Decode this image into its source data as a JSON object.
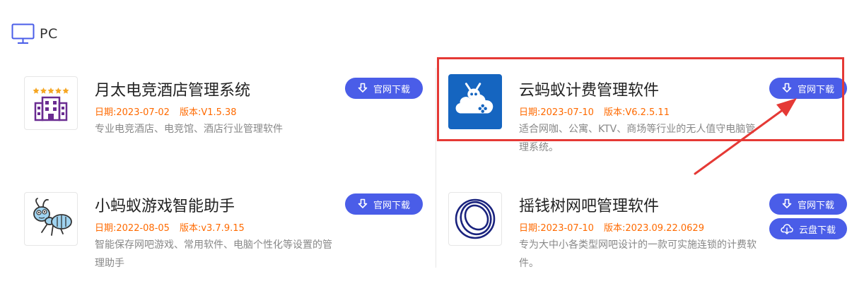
{
  "section": {
    "title": "PC",
    "icon": "monitor-icon"
  },
  "cards": [
    {
      "title": "月太电竞酒店管理系统",
      "date": "日期:2023-07-02",
      "version": "版本:V1.5.38",
      "description": "专业电竞酒店、电竞馆、酒店行业管理软件",
      "logo": "hotel-building-icon",
      "buttons": [
        {
          "label": "官网下载",
          "icon": "download-icon"
        }
      ]
    },
    {
      "title": "云蚂蚁计费管理软件",
      "date": "日期:2023-07-10",
      "version": "版本:V6.2.5.11",
      "description": "适合网咖、公寓、KTV、商场等行业的无人值守电脑管理系统。",
      "logo": "cloud-ant-gamepad-icon",
      "buttons": [
        {
          "label": "官网下载",
          "icon": "download-icon"
        }
      ]
    },
    {
      "title": "小蚂蚁游戏智能助手",
      "date": "日期:2022-08-05",
      "version": "版本:v3.7.9.15",
      "description": "智能保存网吧游戏、常用软件、电脑个性化等设置的管理助手",
      "logo": "ant-mascot-icon",
      "buttons": [
        {
          "label": "官网下载",
          "icon": "download-icon"
        }
      ]
    },
    {
      "title": "摇钱树网吧管理软件",
      "date": "日期:2023-07-10",
      "version": "版本:2023.09.22.0629",
      "description": "专为大中小各类型网吧设计的一款可实施连锁的计费软件。",
      "logo": "blue-rings-icon",
      "buttons": [
        {
          "label": "官网下载",
          "icon": "download-icon"
        },
        {
          "label": "云盘下载",
          "icon": "cloud-download-icon"
        }
      ]
    }
  ],
  "colors": {
    "accent": "#4a5de8",
    "meta": "#ff6a00",
    "highlight": "#e53935",
    "title": "#222222",
    "description": "#888888"
  }
}
